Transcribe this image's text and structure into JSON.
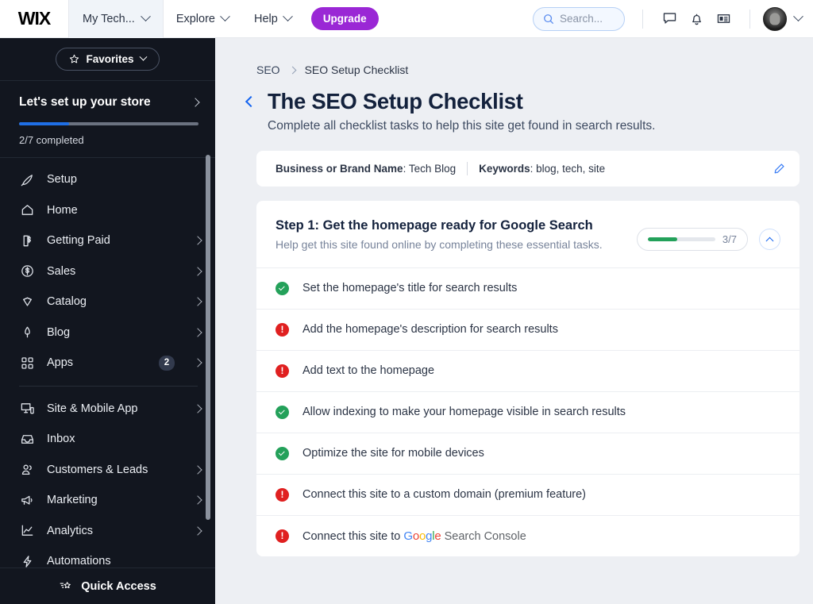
{
  "topbar": {
    "logo": "WIX",
    "site_tab": "My Tech...",
    "nav": [
      {
        "label": "Explore",
        "icon": "chevron-down-icon"
      },
      {
        "label": "Help",
        "icon": "chevron-down-icon"
      }
    ],
    "upgrade_label": "Upgrade",
    "search_placeholder": "Search...",
    "icons": [
      "chat-icon",
      "bell-icon",
      "news-card-icon"
    ],
    "accent_color": "#9a27d5"
  },
  "sidebar": {
    "favorites_label": "Favorites",
    "setup": {
      "title": "Let's set up your store",
      "progress_label": "2/7 completed",
      "progress_percent": 28,
      "progress_color": "#1f6fe5"
    },
    "items": [
      {
        "label": "Setup",
        "icon": "rocket-icon",
        "chevron": false,
        "badge": ""
      },
      {
        "label": "Home",
        "icon": "home-icon",
        "chevron": false,
        "badge": ""
      },
      {
        "label": "Getting Paid",
        "icon": "invoice-dollar-icon",
        "chevron": true,
        "badge": ""
      },
      {
        "label": "Sales",
        "icon": "dollar-circle-icon",
        "chevron": true,
        "badge": ""
      },
      {
        "label": "Catalog",
        "icon": "catalog-cards-icon",
        "chevron": true,
        "badge": ""
      },
      {
        "label": "Blog",
        "icon": "pen-nib-icon",
        "chevron": true,
        "badge": ""
      },
      {
        "label": "Apps",
        "icon": "apps-grid-icon",
        "chevron": true,
        "badge": "2"
      }
    ],
    "items2": [
      {
        "label": "Site & Mobile App",
        "icon": "monitor-mobile-icon",
        "chevron": true,
        "badge": ""
      },
      {
        "label": "Inbox",
        "icon": "inbox-icon",
        "chevron": false,
        "badge": ""
      },
      {
        "label": "Customers & Leads",
        "icon": "people-icon",
        "chevron": true,
        "badge": ""
      },
      {
        "label": "Marketing",
        "icon": "megaphone-icon",
        "chevron": true,
        "badge": ""
      },
      {
        "label": "Analytics",
        "icon": "line-chart-icon",
        "chevron": true,
        "badge": ""
      },
      {
        "label": "Automations",
        "icon": "bolt-icon",
        "chevron": false,
        "badge": ""
      }
    ],
    "footer_label": "Quick Access"
  },
  "main": {
    "breadcrumb": [
      "SEO",
      "SEO Setup Checklist"
    ],
    "page_title": "The SEO Setup Checklist",
    "page_subtitle": "Complete all checklist tasks to help this site get found in search results.",
    "info": {
      "brand_label": "Business or Brand Name",
      "brand_value": ": Tech Blog",
      "keywords_label": "Keywords",
      "keywords_value": ": blog, tech, site"
    },
    "step": {
      "title": "Step 1: Get the homepage ready for Google Search",
      "description": "Help get this site found online by completing these essential tasks.",
      "progress_count": "3/7",
      "progress_percent": 43,
      "progress_color": "#23a15a"
    },
    "tasks": [
      {
        "label": "Set the homepage's title for search results",
        "status": "done"
      },
      {
        "label": "Add the homepage's description for search results",
        "status": "todo"
      },
      {
        "label": "Add text to the homepage",
        "status": "todo"
      },
      {
        "label": "Allow indexing to make your homepage visible in search results",
        "status": "done"
      },
      {
        "label": "Optimize the site for mobile devices",
        "status": "done"
      },
      {
        "label": "Connect this site to a custom domain (premium feature)",
        "status": "todo"
      },
      {
        "label": "Connect this site to ",
        "status": "todo",
        "google_logo": true,
        "suffix": "Search Console"
      }
    ]
  }
}
